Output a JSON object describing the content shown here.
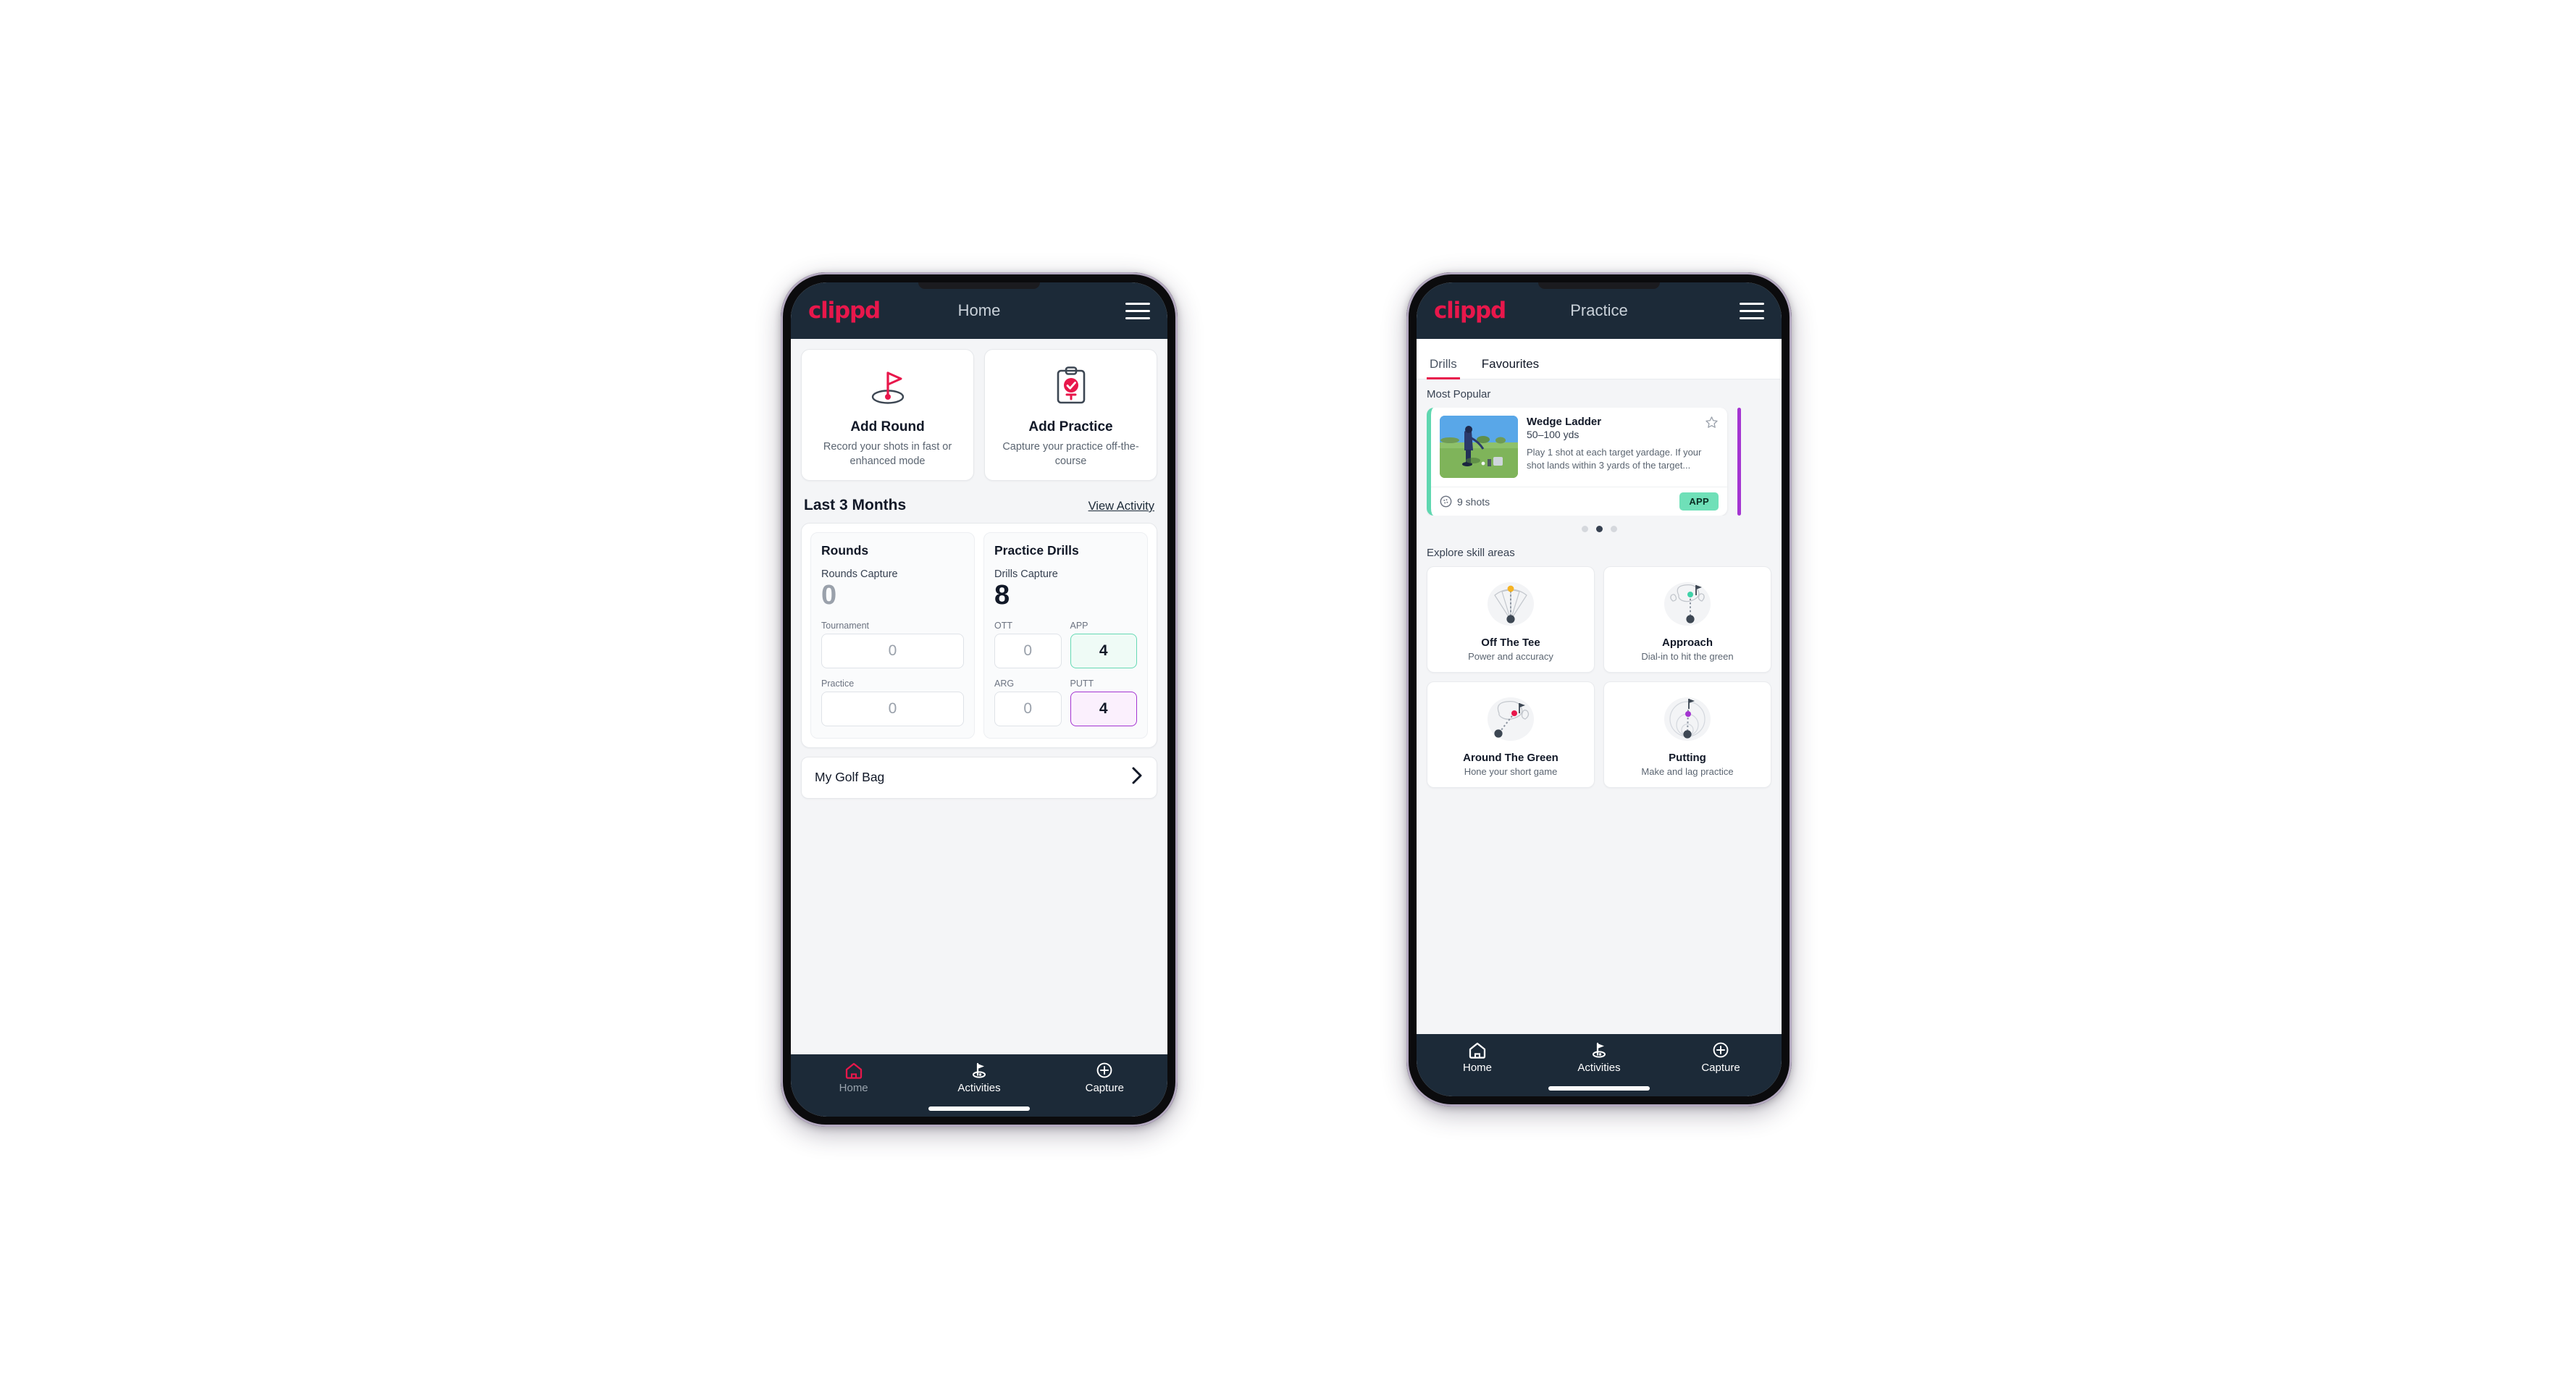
{
  "brand": {
    "logo_text": "clippd",
    "accent": "#e8174b",
    "dark": "#1c2a38"
  },
  "phone_home": {
    "appbar": {
      "title": "Home",
      "menu_icon": "hamburger-menu-icon"
    },
    "quick_actions": [
      {
        "icon": "golf-flag-hole-icon",
        "title": "Add Round",
        "subtitle": "Record your shots in fast or enhanced mode"
      },
      {
        "icon": "clipboard-check-icon",
        "title": "Add Practice",
        "subtitle": "Capture your practice off-the-course"
      }
    ],
    "section": {
      "title": "Last 3 Months",
      "link": "View Activity"
    },
    "rounds": {
      "heading": "Rounds",
      "capture_label": "Rounds Capture",
      "capture_value": "0",
      "fields": [
        {
          "label": "Tournament",
          "value": "0",
          "state": "default"
        },
        {
          "label": "Practice",
          "value": "0",
          "state": "default"
        }
      ]
    },
    "drills": {
      "heading": "Practice Drills",
      "capture_label": "Drills Capture",
      "capture_value": "8",
      "fields": [
        {
          "label": "OTT",
          "value": "0",
          "state": "default"
        },
        {
          "label": "APP",
          "value": "4",
          "state": "app"
        },
        {
          "label": "ARG",
          "value": "0",
          "state": "default"
        },
        {
          "label": "PUTT",
          "value": "4",
          "state": "putt"
        }
      ]
    },
    "golf_bag": {
      "label": "My Golf Bag",
      "chevron": "chevron-right-icon"
    },
    "bottom_nav": [
      {
        "icon": "home-icon",
        "label": "Home",
        "active": true
      },
      {
        "icon": "golf-flag-icon",
        "label": "Activities",
        "active": false
      },
      {
        "icon": "plus-circle-icon",
        "label": "Capture",
        "active": false
      }
    ]
  },
  "phone_practice": {
    "appbar": {
      "title": "Practice",
      "menu_icon": "hamburger-menu-icon"
    },
    "tabs": [
      {
        "label": "Drills",
        "active": true
      },
      {
        "label": "Favourites",
        "active": false
      }
    ],
    "most_popular_label": "Most Popular",
    "drill": {
      "name": "Wedge Ladder",
      "yards": "50–100 yds",
      "description": "Play 1 shot at each target yardage. If your shot lands within 3 yards of the target...",
      "shots": "9 shots",
      "shots_icon": "golf-ball-icon",
      "badge": "APP",
      "badge_color": "#6fe0b8",
      "accent_color": "#5fd7b0",
      "next_accent_color": "#a435d1",
      "favourite_icon": "star-outline-icon"
    },
    "pagination": {
      "count": 3,
      "active_index": 1
    },
    "skills_label": "Explore skill areas",
    "skills": [
      {
        "icon": "tee-fan-icon",
        "name": "Off The Tee",
        "sub": "Power and accuracy",
        "dot_color": "#f5b324"
      },
      {
        "icon": "green-approach-icon",
        "name": "Approach",
        "sub": "Dial-in to hit the green",
        "dot_color": "#3fd2a8"
      },
      {
        "icon": "chip-green-icon",
        "name": "Around The Green",
        "sub": "Hone your short game",
        "dot_color": "#e8174b"
      },
      {
        "icon": "putting-rings-icon",
        "name": "Putting",
        "sub": "Make and lag practice",
        "dot_color": "#a435d1"
      }
    ],
    "bottom_nav": [
      {
        "icon": "home-icon",
        "label": "Home",
        "active": false
      },
      {
        "icon": "golf-flag-icon",
        "label": "Activities",
        "active": false
      },
      {
        "icon": "plus-circle-icon",
        "label": "Capture",
        "active": false
      }
    ]
  }
}
